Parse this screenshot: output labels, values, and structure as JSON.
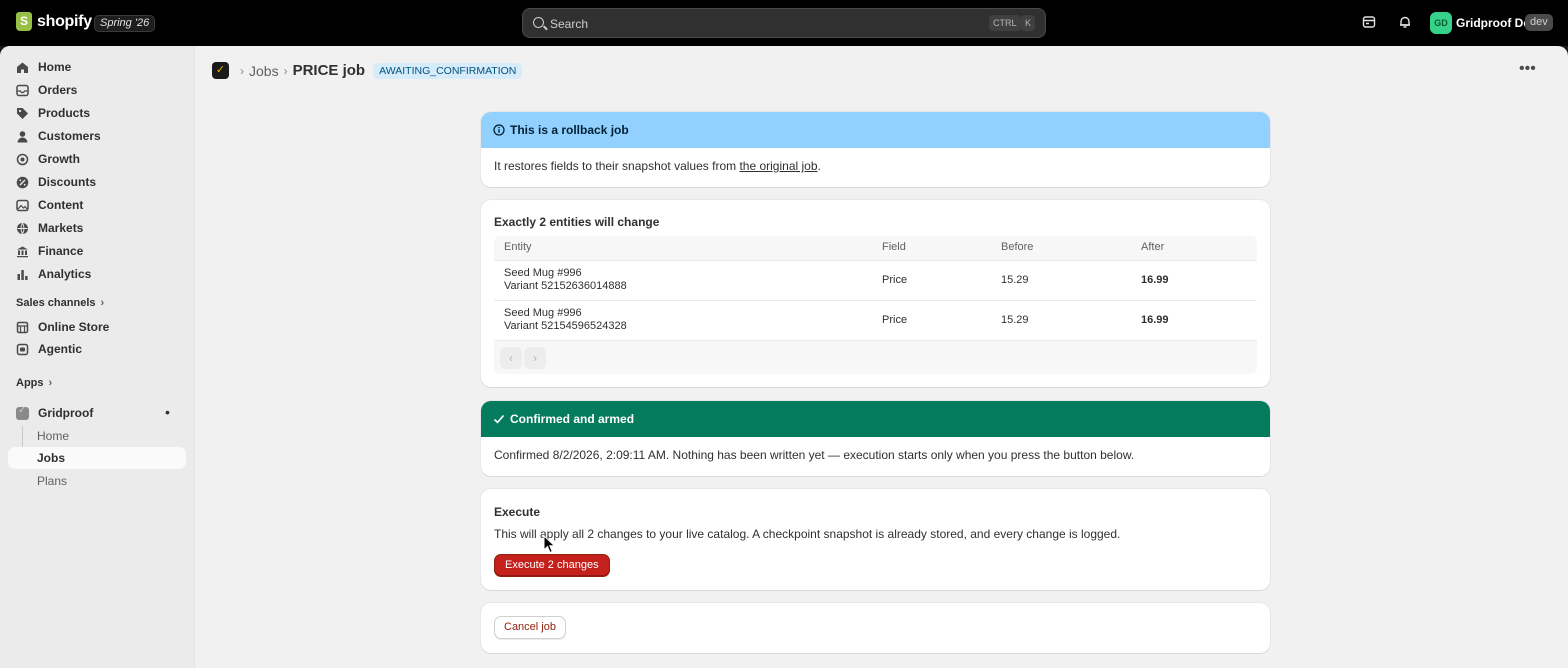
{
  "colors": {
    "topbar_bg": "#000000",
    "info_banner": "#91d0ff",
    "success_banner": "#047b5d",
    "danger_button": "#c4201c",
    "status_badge_bg": "#d7ecfb"
  },
  "topbar": {
    "brand": "shopify",
    "edition": "Spring '26",
    "search_placeholder": "Search",
    "shortcut_ctrl": "CTRL",
    "shortcut_key": "K",
    "avatar_initials": "GD",
    "store_name": "Gridproof Dev",
    "env_badge": "dev"
  },
  "sidebar": {
    "items": [
      {
        "label": "Home",
        "icon": "home-icon"
      },
      {
        "label": "Orders",
        "icon": "inbox-icon"
      },
      {
        "label": "Products",
        "icon": "tag-icon"
      },
      {
        "label": "Customers",
        "icon": "person-icon"
      },
      {
        "label": "Growth",
        "icon": "target-icon"
      },
      {
        "label": "Discounts",
        "icon": "discount-icon"
      },
      {
        "label": "Content",
        "icon": "content-icon"
      },
      {
        "label": "Markets",
        "icon": "globe-icon"
      },
      {
        "label": "Finance",
        "icon": "bank-icon"
      },
      {
        "label": "Analytics",
        "icon": "chart-icon"
      }
    ],
    "sales_channels_title": "Sales channels",
    "channels": [
      {
        "label": "Online Store",
        "icon": "store-icon"
      },
      {
        "label": "Agentic",
        "icon": "agent-icon"
      }
    ],
    "apps_title": "Apps",
    "app_name": "Gridproof",
    "app_dot": "•",
    "app_subitems": [
      "Home",
      "Jobs",
      "Plans"
    ]
  },
  "breadcrumb": {
    "parent": "Jobs",
    "title": "PRICE job",
    "status": "AWAITING_CONFIRMATION"
  },
  "rollback_banner": {
    "title": "This is a rollback job",
    "body_prefix": "It restores fields to their snapshot values from ",
    "link": "the original job",
    "body_suffix": "."
  },
  "changes": {
    "title": "Exactly 2 entities will change",
    "columns": [
      "Entity",
      "Field",
      "Before",
      "After"
    ],
    "rows": [
      {
        "entity": "Seed Mug #996",
        "variant": "Variant 52152636014888",
        "field": "Price",
        "before": "15.29",
        "after": "16.99"
      },
      {
        "entity": "Seed Mug #996",
        "variant": "Variant 52154596524328",
        "field": "Price",
        "before": "15.29",
        "after": "16.99"
      }
    ]
  },
  "confirmed_banner": {
    "title": "Confirmed and armed",
    "body": "Confirmed 8/2/2026, 2:09:11 AM. Nothing has been written yet — execution starts only when you press the button below."
  },
  "execute": {
    "title": "Execute",
    "body": "This will apply all 2 changes to your live catalog. A checkpoint snapshot is already stored, and every change is logged.",
    "button": "Execute 2 changes"
  },
  "cancel": {
    "button": "Cancel job"
  }
}
